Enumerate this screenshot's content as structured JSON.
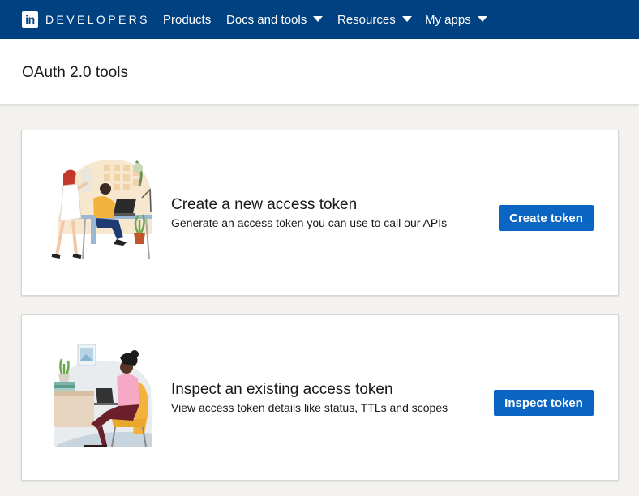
{
  "nav": {
    "brand_logo_text": "in",
    "brand_text": "DEVELOPERS",
    "items": [
      {
        "label": "Products",
        "has_dropdown": false
      },
      {
        "label": "Docs and tools",
        "has_dropdown": true
      },
      {
        "label": "Resources",
        "has_dropdown": true
      },
      {
        "label": "My apps",
        "has_dropdown": true
      }
    ]
  },
  "page": {
    "title": "OAuth 2.0 tools"
  },
  "cards": [
    {
      "title": "Create a new access token",
      "description": "Generate an access token you can use to call our APIs",
      "button_label": "Create token",
      "illustration": "team-working-illustration"
    },
    {
      "title": "Inspect an existing access token",
      "description": "View access token details like status, TTLs and scopes",
      "button_label": "Inspect token",
      "illustration": "person-reviewing-laptop-illustration"
    }
  ],
  "colors": {
    "navbar": "#004182",
    "primary_button": "#0a66c2",
    "page_background": "#f3f2ef",
    "card_background": "#ffffff"
  }
}
